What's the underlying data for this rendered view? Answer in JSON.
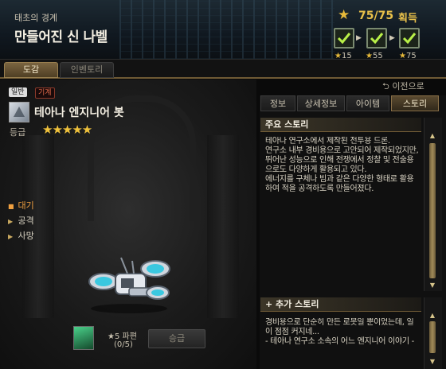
{
  "header": {
    "zone": "태초의 경계",
    "title": "만들어진 신 나벨",
    "progress": "75/75",
    "acquire_label": "획득",
    "achievements": [
      {
        "label": "15"
      },
      {
        "label": "55"
      },
      {
        "label": "75"
      }
    ]
  },
  "tabs": {
    "dogam": "도감",
    "inventory": "인벤토리"
  },
  "back_label": "이전으로",
  "item": {
    "badge_normal": "일반",
    "badge_type": "기계",
    "name": "테아나 엔지니어 봇",
    "grade_label": "등급",
    "grade_stars": "★★★★★",
    "actions": [
      "대기",
      "공격",
      "사망"
    ],
    "fragment_label": "★5 파편",
    "fragment_count": "(0/5)",
    "upgrade_label": "승급"
  },
  "info_tabs": [
    "정보",
    "상세정보",
    "아이템",
    "스토리"
  ],
  "story": {
    "main_heading": "주요 스토리",
    "main_text": "테아나 연구소에서 제작된 전투용 드론.\n연구소 내부 경비용으로 고안되어 제작되었지만, 뛰어난 성능으로 인해 전쟁에서 정찰 및 전술용으로도 다양하게 활용되고 있다.\n에너지를 구체나 빔과 같은 다양한 형태로 활용하여 적을 공격하도록 만들어졌다.",
    "extra_heading": "+ 추가 스토리",
    "extra_text": "경비용으로 단순히 만든 로봇일 뿐이었는데, 일이 점점 커지네...\n- 테아나 연구소 소속의 어느 엔지니어 이야기 -"
  },
  "colors": {
    "accent_gold": "#e8c04a",
    "active_orange": "#f0a040"
  }
}
